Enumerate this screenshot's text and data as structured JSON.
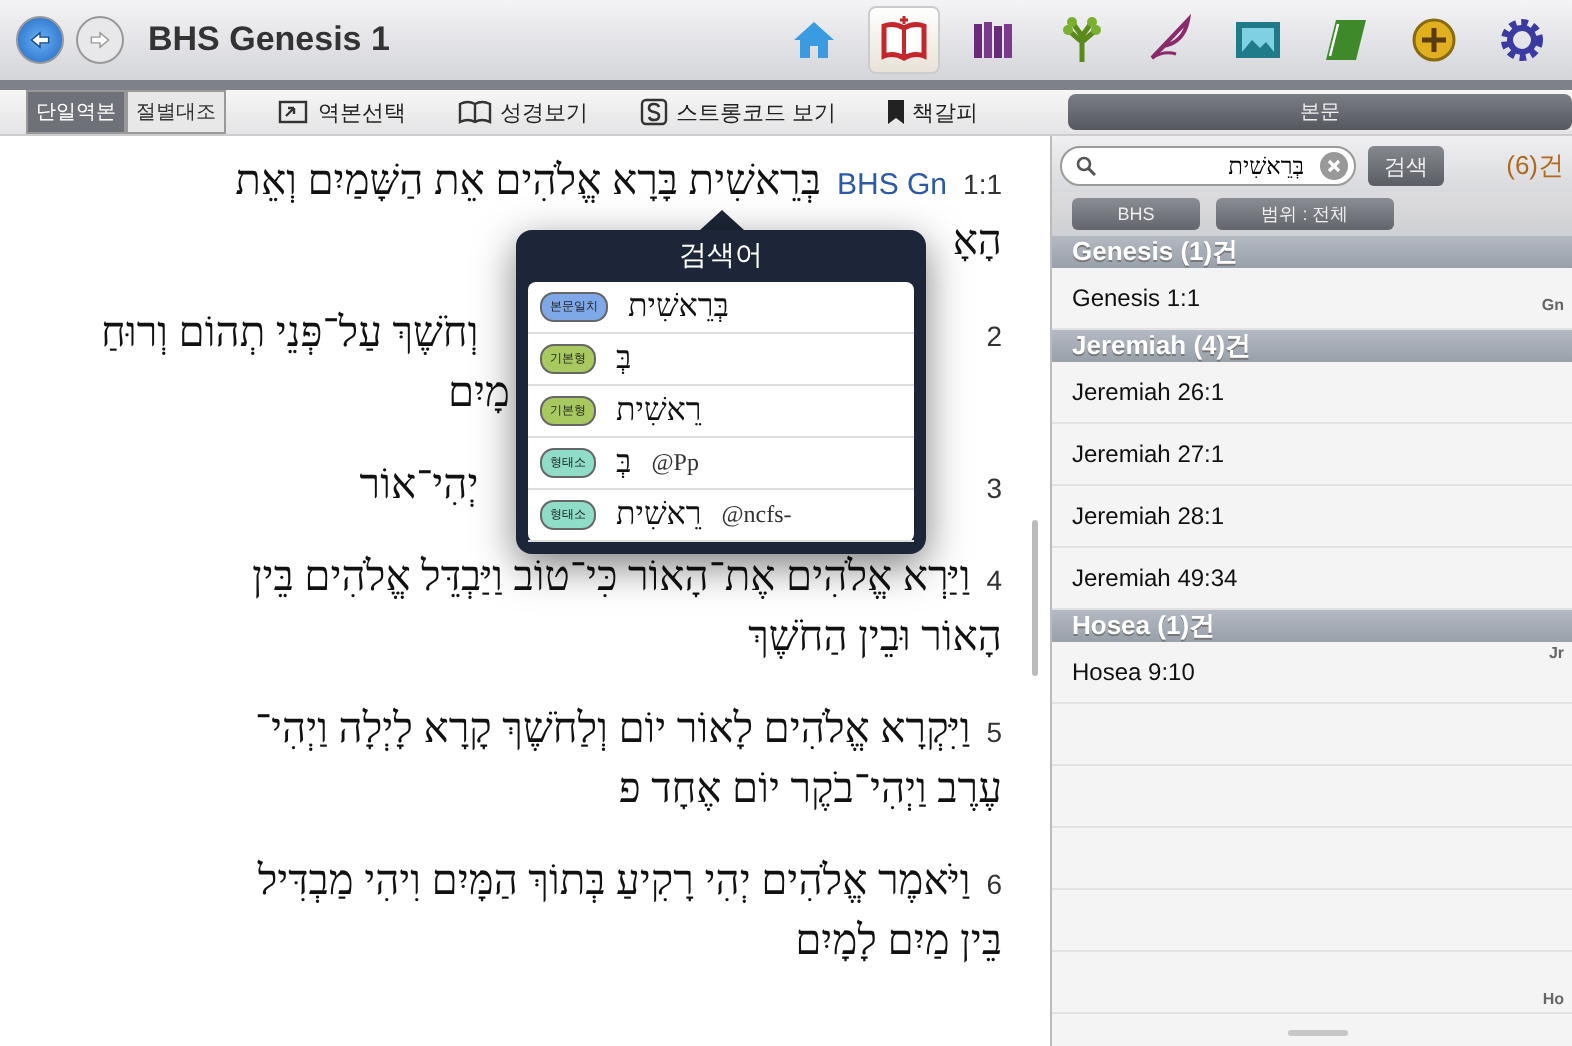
{
  "window": {
    "title": "BHS Genesis 1"
  },
  "nav": [
    {
      "kind": "back"
    },
    {
      "kind": "forward"
    }
  ],
  "toolbar_icons": [
    {
      "kind": "home",
      "selected": false
    },
    {
      "kind": "bible",
      "selected": true
    },
    {
      "kind": "library",
      "selected": false
    },
    {
      "kind": "tree",
      "selected": false
    },
    {
      "kind": "quill",
      "selected": false
    },
    {
      "kind": "picture",
      "selected": false
    },
    {
      "kind": "notebook",
      "selected": false
    },
    {
      "kind": "emblem",
      "selected": false
    },
    {
      "kind": "settings",
      "selected": false
    }
  ],
  "view_toggle": {
    "single": {
      "label": "단일역본",
      "selected": true
    },
    "parallel": {
      "label": "절별대조",
      "selected": false
    }
  },
  "actions": {
    "version": "역본선택",
    "bible": "성경보기",
    "strong": "스트롱코드 보기",
    "bookmark": "책갈피"
  },
  "verses": [
    {
      "number": "1:1",
      "ref": "BHS Gn",
      "lines": [
        {
          "kind": "full",
          "text": "בְּרֵאשִׁית בָּרָא אֱלֹהִים אֵת הַשָּׁמַיִם וְאֵת"
        },
        {
          "kind": "full",
          "text": "הָאָ"
        }
      ]
    },
    {
      "number": "2",
      "lines": [
        {
          "kind": "fragment",
          "text": "וְחֹשֶׁךְ עַל־פְּנֵי תְהוֹם וְרוּחַ"
        },
        {
          "kind": "fragment",
          "text": "מָיִם"
        }
      ]
    },
    {
      "number": "3",
      "lines": [
        {
          "kind": "fragment",
          "text": "יְהִי־אוֹר"
        }
      ]
    },
    {
      "number": "4",
      "lines": [
        {
          "kind": "full",
          "text": "וַיַּרְא אֱלֹהִים אֶת־הָאוֹר כִּי־טוֹב וַיַּבְדֵּל אֱלֹהִים בֵּין"
        },
        {
          "kind": "full",
          "text": "הָאוֹר וּבֵין הַחֹשֶׁךְ"
        }
      ]
    },
    {
      "number": "5",
      "lines": [
        {
          "kind": "full",
          "text": "וַיִּקְרָא אֱלֹהִים לָאוֹר יוֹם וְלַחֹשֶׁךְ קָרָא לָיְלָה וַיְהִי־"
        },
        {
          "kind": "full",
          "text": "עֶרֶב וַיְהִי־בֹקֶר יוֹם אֶחָד פ"
        }
      ]
    },
    {
      "number": "6",
      "lines": [
        {
          "kind": "full",
          "text": "וַיֹּאמֶר אֱלֹהִים יְהִי רָקִיעַ בְּתוֹךְ הַמָּיִם וִיהִי מַבְדִּיל"
        },
        {
          "kind": "full",
          "text": "בֵּין מַיִם לָמָיִם"
        }
      ]
    }
  ],
  "popover": {
    "title": "검색어",
    "items": [
      {
        "kind": "match",
        "badge": "본문일치",
        "text": "בְּרֵאשִׁית"
      },
      {
        "kind": "lemma",
        "badge": "기본형",
        "text": "בְּ"
      },
      {
        "kind": "lemma",
        "badge": "기본형",
        "text": "רֵאשִׁית"
      },
      {
        "kind": "morph",
        "badge": "형태소",
        "text": "בְּ",
        "suffix": "@Pp"
      },
      {
        "kind": "morph",
        "badge": "형태소",
        "text": "רֵאשִׁית",
        "suffix": "@ncfs-"
      }
    ]
  },
  "panel": {
    "header": "본문",
    "search": {
      "value": "בְּרֵאשִׁית"
    },
    "search_button": "검색",
    "count": "(6)건",
    "filters": {
      "version": "BHS",
      "range": "범위 : 전체"
    },
    "sections": [
      {
        "title": "Genesis (1)건",
        "rows": [
          "Genesis 1:1"
        ]
      },
      {
        "title": "Jeremiah (4)건",
        "rows": [
          "Jeremiah 26:1",
          "Jeremiah 27:1",
          "Jeremiah 28:1",
          "Jeremiah 49:34"
        ]
      },
      {
        "title": "Hosea (1)건",
        "rows": [
          "Hosea 9:10"
        ]
      }
    ],
    "index": [
      "Gn",
      "Jr",
      "Ho"
    ]
  }
}
